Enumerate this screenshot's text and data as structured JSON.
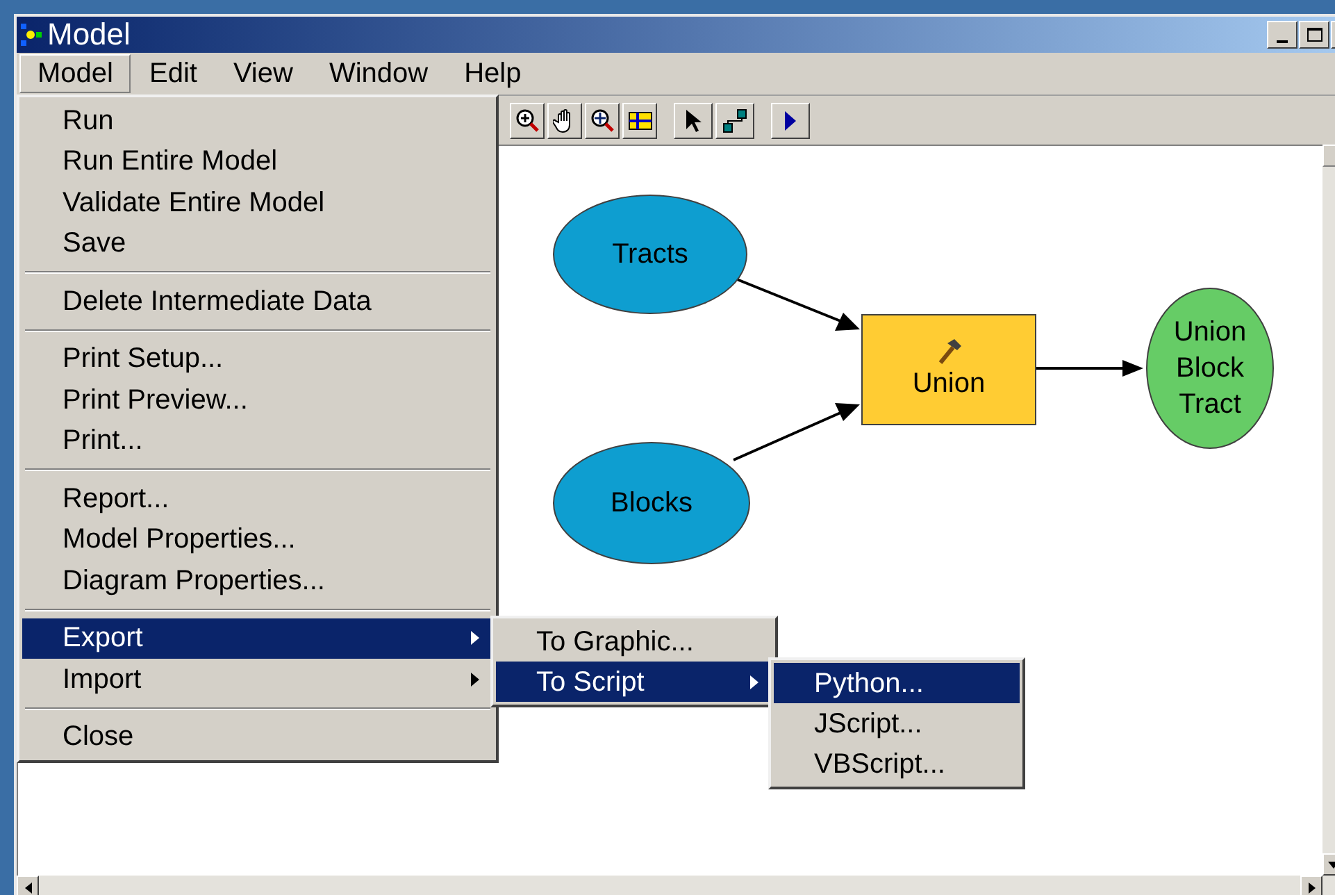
{
  "window": {
    "title": "Model"
  },
  "menu_bar": [
    {
      "label": "Model",
      "selected": true
    },
    {
      "label": "Edit",
      "selected": false
    },
    {
      "label": "View",
      "selected": false
    },
    {
      "label": "Window",
      "selected": false
    },
    {
      "label": "Help",
      "selected": false
    }
  ],
  "model_menu": {
    "groups": [
      [
        {
          "label": "Run",
          "selected": false,
          "submenu": false
        },
        {
          "label": "Run Entire Model",
          "selected": false,
          "submenu": false
        },
        {
          "label": "Validate Entire Model",
          "selected": false,
          "submenu": false
        },
        {
          "label": "Save",
          "selected": false,
          "submenu": false
        }
      ],
      [
        {
          "label": "Delete Intermediate Data",
          "selected": false,
          "submenu": false
        }
      ],
      [
        {
          "label": "Print Setup...",
          "selected": false,
          "submenu": false
        },
        {
          "label": "Print Preview...",
          "selected": false,
          "submenu": false
        },
        {
          "label": "Print...",
          "selected": false,
          "submenu": false
        }
      ],
      [
        {
          "label": "Report...",
          "selected": false,
          "submenu": false
        },
        {
          "label": "Model Properties...",
          "selected": false,
          "submenu": false
        },
        {
          "label": "Diagram Properties...",
          "selected": false,
          "submenu": false
        }
      ],
      [
        {
          "label": "Export",
          "selected": true,
          "submenu": true
        },
        {
          "label": "Import",
          "selected": false,
          "submenu": true
        }
      ],
      [
        {
          "label": "Close",
          "selected": false,
          "submenu": false
        }
      ]
    ]
  },
  "export_menu": [
    {
      "label": "To Graphic...",
      "selected": false,
      "submenu": false
    },
    {
      "label": "To Script",
      "selected": true,
      "submenu": true
    }
  ],
  "script_menu": [
    {
      "label": "Python...",
      "selected": true
    },
    {
      "label": "JScript...",
      "selected": false
    },
    {
      "label": "VBScript...",
      "selected": false
    }
  ],
  "diagram": {
    "nodes": [
      {
        "label": "Tracts",
        "kind": "data",
        "color": "#0e9ed0"
      },
      {
        "label": "Blocks",
        "kind": "data",
        "color": "#0e9ed0"
      },
      {
        "label": "Union",
        "kind": "tool",
        "color": "#ffcc33"
      },
      {
        "label": "Union Block Tract",
        "kind": "output",
        "color": "#66cc66"
      }
    ]
  }
}
